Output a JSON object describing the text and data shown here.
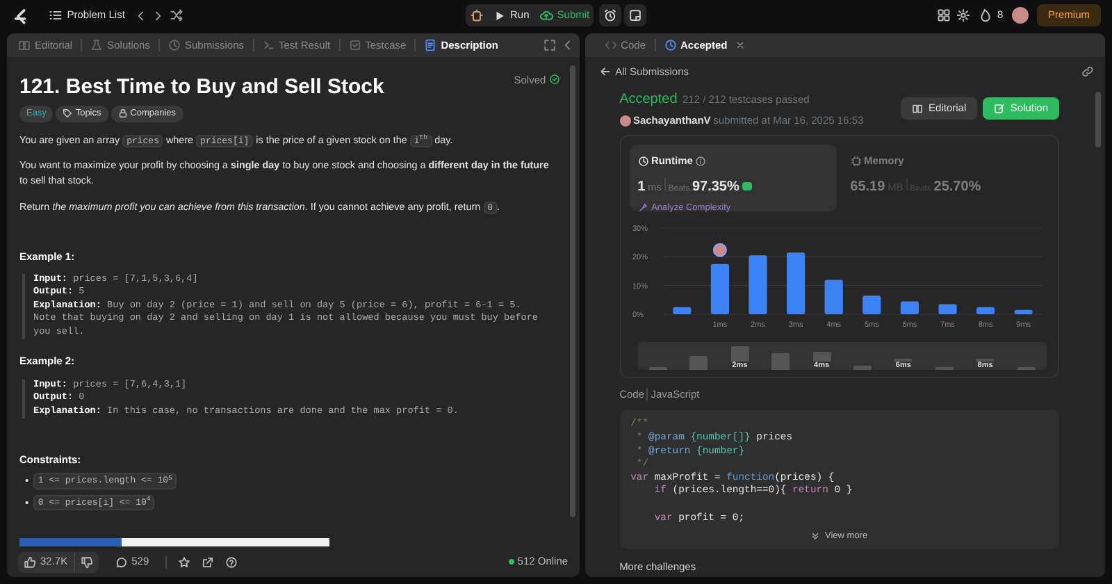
{
  "top_bar": {
    "nav_label": "Problem List",
    "run": "Run",
    "submit": "Submit",
    "streak": "8",
    "premium": "Premium"
  },
  "left_tabs": [
    {
      "label": "Editorial",
      "selected": false
    },
    {
      "label": "Solutions",
      "selected": false
    },
    {
      "label": "Submissions",
      "selected": false
    },
    {
      "label": "Test Result",
      "selected": false
    },
    {
      "label": "Testcase",
      "selected": false
    },
    {
      "label": "Description",
      "selected": true
    }
  ],
  "problem": {
    "title": "121. Best Time to Buy and Sell Stock",
    "status": "Solved",
    "difficulty": "Easy",
    "tags": [
      "Topics",
      "Companies"
    ],
    "paragraphs": [
      [
        {
          "kind": "text",
          "text": "You are given an array "
        },
        {
          "kind": "code",
          "text": "prices"
        },
        {
          "kind": "text",
          "text": " where "
        },
        {
          "kind": "code",
          "text": "prices[i]"
        },
        {
          "kind": "text",
          "text": " is the price of a given stock on the "
        },
        {
          "kind": "code",
          "text": "i$^{th}$"
        },
        {
          "kind": "text",
          "text": " day."
        }
      ],
      [
        {
          "kind": "text",
          "text": "You want to maximize your profit by choosing a **single day** to buy one stock and choosing a **different day in the future** to sell that stock."
        }
      ],
      [
        {
          "kind": "text",
          "text": "Return *the maximum profit you can achieve from this transaction*. If you cannot achieve any profit, return "
        },
        {
          "kind": "code",
          "text": "0"
        },
        {
          "kind": "text",
          "text": "."
        }
      ]
    ],
    "examples": [
      {
        "heading": "Example 1:",
        "lines": [
          {
            "label": "Input:",
            "value": "prices = [7,1,5,3,6,4]"
          },
          {
            "label": "Output:",
            "value": "5"
          },
          {
            "label": "Explanation:",
            "value": "Buy on day 2 (price = 1) and sell on day 5 (price = 6), profit = 6-1 = 5.\nNote that buying on day 2 and selling on day 1 is not allowed because you must buy before you sell."
          }
        ]
      },
      {
        "heading": "Example 2:",
        "lines": [
          {
            "label": "Input:",
            "value": "prices = [7,6,4,3,1]"
          },
          {
            "label": "Output:",
            "value": "0"
          },
          {
            "label": "Explanation:",
            "value": "In this case, no transactions are done and the max profit = 0."
          }
        ]
      }
    ],
    "constraints_heading": "Constraints:",
    "constraints": [
      {
        "bullet": "•",
        "text": "1 <= prices.length <= 10$^{5}$"
      },
      {
        "bullet": "•",
        "text": "0 <= prices[i] <= 10$^{4}$"
      }
    ]
  },
  "footer": {
    "likes": "32.7K",
    "comments": "529",
    "online": "512 Online"
  },
  "right_tabs": [
    {
      "label": "Code",
      "selected": false,
      "closable": false
    },
    {
      "label": "Accepted",
      "selected": true,
      "closable": true
    }
  ],
  "submission": {
    "back_link": "All Submissions",
    "verdict": "Accepted",
    "testcases": "212 / 212 testcases passed",
    "user": "SachayanthanV",
    "submitted": "submitted at Mar 16, 2025 16:53",
    "buttons": [
      {
        "label": "Editorial",
        "kind": "secondary"
      },
      {
        "label": "Solution",
        "kind": "primary"
      }
    ],
    "stats": [
      {
        "title": "Runtime",
        "value": "1",
        "unit": "ms",
        "beats_label": "Beats",
        "beats": "97.35%",
        "selected": true,
        "action": "Analyze Complexity"
      },
      {
        "title": "Memory",
        "value": "65.19",
        "unit": "MB",
        "beats_label": "Beats",
        "beats": "25.70%",
        "selected": false
      }
    ],
    "chart_data": {
      "type": "bar",
      "categories": [
        null,
        "1ms",
        "2ms",
        "3ms",
        "4ms",
        "5ms",
        "6ms",
        "7ms",
        "8ms",
        "9ms"
      ],
      "series": [
        {
          "color": "#3b82f6",
          "values": [
            2.5,
            17.5,
            20.5,
            21.5,
            12,
            6.5,
            4.5,
            3.5,
            2.5,
            1.5
          ]
        }
      ],
      "ylim": [
        0,
        30
      ],
      "yticks": [
        {
          "value": 0,
          "label": "0%"
        },
        {
          "value": 10,
          "label": "10%"
        },
        {
          "value": 20,
          "label": "20%"
        },
        {
          "value": 30,
          "label": "30%"
        }
      ]
    },
    "minimap_labels": [
      "2ms",
      "4ms",
      "6ms",
      "8ms"
    ],
    "code_header": {
      "section": "Code",
      "language": "JavaScript"
    },
    "code_tokens": [
      {
        "kind": "comment",
        "text": "/**\n *"
      },
      {
        "kind": "tag",
        "text": " @param"
      },
      {
        "kind": "type",
        "text": " {number[]}"
      },
      {
        "kind": "plain",
        "text": " prices"
      },
      {
        "kind": "comment",
        "text": "\n *"
      },
      {
        "kind": "tag",
        "text": " @return"
      },
      {
        "kind": "type",
        "text": " {number}"
      },
      {
        "kind": "comment",
        "text": "\n */"
      },
      {
        "kind": "kw",
        "text": "\nvar"
      },
      {
        "kind": "plain",
        "text": " maxProfit = "
      },
      {
        "kind": "fn",
        "text": "function"
      },
      {
        "kind": "plain",
        "text": "(prices) {"
      },
      {
        "kind": "kw",
        "text": "\n    if"
      },
      {
        "kind": "plain",
        "text": " (prices.length==0){ "
      },
      {
        "kind": "kw",
        "text": "return"
      },
      {
        "kind": "plain",
        "text": " 0 }"
      },
      {
        "kind": "kw",
        "text": "\n\n    var"
      },
      {
        "kind": "plain",
        "text": " profit = 0;"
      }
    ],
    "view_more": "View more",
    "more_challenges": "More challenges"
  }
}
